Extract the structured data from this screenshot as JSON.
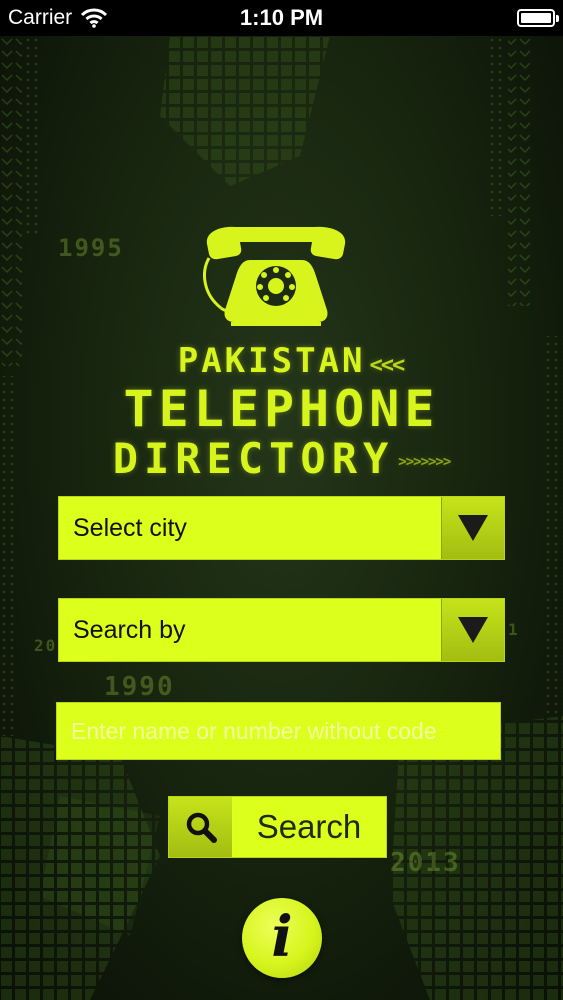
{
  "status_bar": {
    "carrier": "Carrier",
    "time": "1:10 PM",
    "battery_level": 1.0
  },
  "title": {
    "line1": "PAKISTAN",
    "line1_chevrons": "<<<",
    "line2": "TELEPHONE",
    "line3": "DIRECTORY",
    "line3_chevrons": ">>>>>>>"
  },
  "city_dropdown": {
    "label": "Select city"
  },
  "search_by_dropdown": {
    "label": "Search by"
  },
  "search_input": {
    "placeholder": "Enter name or number without code",
    "value": ""
  },
  "search_button": {
    "label": "Search"
  },
  "info_button": {
    "label": "i"
  },
  "background_years": {
    "y1995": "1995",
    "y1990": "1990",
    "y2013": "2013",
    "partial_left": "20",
    "partial_right": "1"
  },
  "colors": {
    "accent": "#dcff1c",
    "accent_dark": "#a3bd12",
    "background": "#18260f",
    "text_dark": "#111111",
    "placeholder": "#f2ff9c"
  },
  "icons": {
    "phone": "rotary-telephone-icon",
    "arrow": "triangle-down-icon",
    "search": "magnifier-icon",
    "info": "info-icon",
    "wifi": "wifi-icon",
    "battery": "battery-icon"
  }
}
